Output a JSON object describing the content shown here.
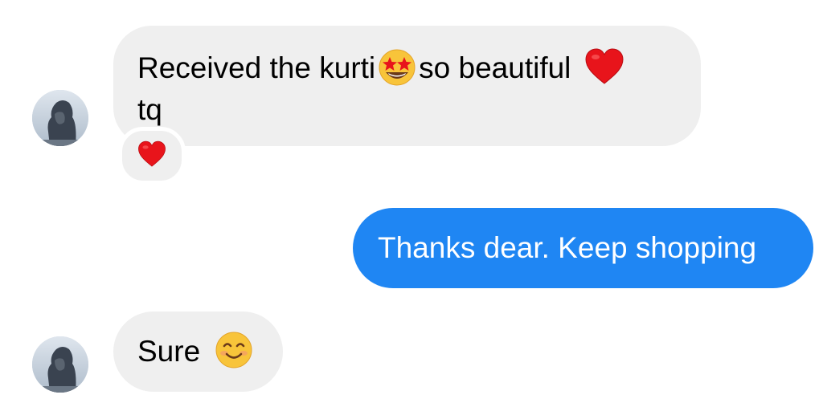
{
  "thread": {
    "messages": [
      {
        "direction": "incoming",
        "line1_part1": "Received the kurti",
        "line1_emoji1": "star-struck-emoji",
        "line1_part2": "so beautiful",
        "line1_emoji2": "red-heart-emoji",
        "line2": "tq",
        "reaction": "red-heart-emoji"
      },
      {
        "direction": "outgoing",
        "text": "Thanks dear. Keep shopping"
      },
      {
        "direction": "incoming",
        "text": "Sure",
        "emoji": "smiling-face-emoji"
      }
    ]
  },
  "colors": {
    "incoming_bubble": "#efefef",
    "outgoing_bubble": "#1f86f3",
    "outgoing_text": "#ffffff",
    "heart": "#e8141b",
    "emoji_face": "#f8c43a"
  }
}
